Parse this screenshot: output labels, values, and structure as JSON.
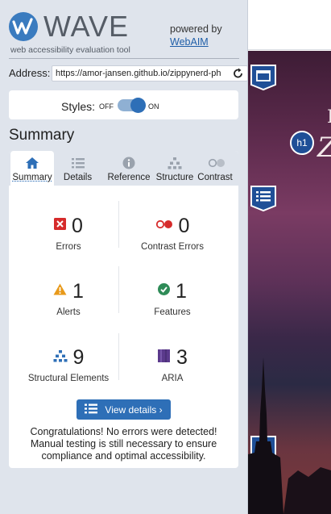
{
  "brand": {
    "name": "WAVE",
    "tagline": "web accessibility evaluation tool",
    "powered_by": "powered by",
    "powered_link": "WebAIM"
  },
  "address": {
    "label": "Address:",
    "value": "https://amor-jansen.github.io/zippynerd-ph"
  },
  "styles_toggle": {
    "label": "Styles:",
    "off_label": "OFF",
    "on_label": "ON",
    "state": "on"
  },
  "section_title": "Summary",
  "tabs": [
    {
      "label": "Summary",
      "icon": "home-icon",
      "active": true
    },
    {
      "label": "Details",
      "icon": "list-icon",
      "active": false
    },
    {
      "label": "Reference",
      "icon": "info-icon",
      "active": false
    },
    {
      "label": "Structure",
      "icon": "structure-icon",
      "active": false
    },
    {
      "label": "Contrast",
      "icon": "contrast-icon",
      "active": false
    }
  ],
  "stats": {
    "errors": {
      "count": "0",
      "label": "Errors"
    },
    "contrast_errors": {
      "count": "0",
      "label": "Contrast Errors"
    },
    "alerts": {
      "count": "1",
      "label": "Alerts"
    },
    "features": {
      "count": "1",
      "label": "Features"
    },
    "structural": {
      "count": "9",
      "label": "Structural Elements"
    },
    "aria": {
      "count": "3",
      "label": "ARIA"
    }
  },
  "view_details_label": "View details ›",
  "congrats_message": "Congratulations! No errors were detected! Manual testing is still necessary to ensure compliance and optimal accessibility.",
  "page_preview": {
    "hero_letter": "H",
    "hero_script": "Z",
    "h1_badge": "h1"
  },
  "colors": {
    "accent": "#2e6fb7",
    "error": "#d62b2b",
    "alert": "#e89a1b",
    "feature": "#2e8b57",
    "aria": "#5b3a8c",
    "sidebar_bg": "#dfe4ec"
  }
}
